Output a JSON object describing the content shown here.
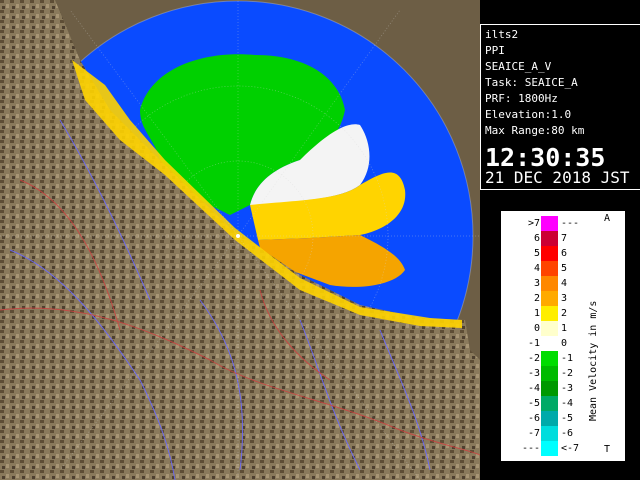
{
  "info": {
    "site": "ilts2",
    "mode": "PPI",
    "product": "SEAICE_A_V",
    "task": "Task: SEAICE_A",
    "prf": "PRF: 1800Hz",
    "elevation": "Elevation:1.0",
    "max_range": "Max Range:80 km",
    "time": "12:30:35",
    "date": "21 DEC 2018 JST"
  },
  "legend": {
    "unit": "Mean Velocity in m/s",
    "tag_top": "A",
    "tag_bottom": "T",
    "rows": [
      {
        "left": ">7",
        "right": "---",
        "color": "#ff00ff"
      },
      {
        "left": "6",
        "right": "7",
        "color": "#cc0033"
      },
      {
        "left": "5",
        "right": "6",
        "color": "#ff0000"
      },
      {
        "left": "4",
        "right": "5",
        "color": "#ff4400"
      },
      {
        "left": "3",
        "right": "4",
        "color": "#ff8800"
      },
      {
        "left": "2",
        "right": "3",
        "color": "#ffaa00"
      },
      {
        "left": "1",
        "right": "2",
        "color": "#ffee00"
      },
      {
        "left": "0",
        "right": "1",
        "color": "#ffffcc"
      },
      {
        "left": "-1",
        "right": "0",
        "color": "#ffffff"
      },
      {
        "left": "-2",
        "right": "-1",
        "color": "#00dd00"
      },
      {
        "left": "-3",
        "right": "-2",
        "color": "#00bb00"
      },
      {
        "left": "-4",
        "right": "-3",
        "color": "#009900"
      },
      {
        "left": "-5",
        "right": "-4",
        "color": "#00aa66"
      },
      {
        "left": "-6",
        "right": "-5",
        "color": "#00aaaa"
      },
      {
        "left": "-7",
        "right": "-6",
        "color": "#00dddd"
      },
      {
        "left": "---",
        "right": "<-7",
        "color": "#00ffff"
      }
    ]
  }
}
